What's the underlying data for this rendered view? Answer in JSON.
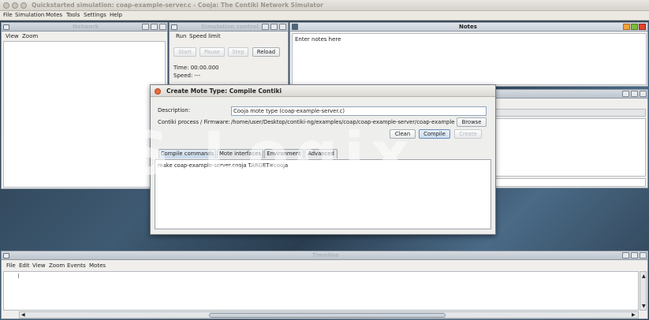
{
  "window": {
    "title": "Quickstarted simulation: coap-example-server.c - Cooja: The Contiki Network Simulator"
  },
  "menubar": [
    "File",
    "Simulation",
    "Motes",
    "Tools",
    "Settings",
    "Help"
  ],
  "network": {
    "title": "Network",
    "menu": [
      "View",
      "Zoom"
    ]
  },
  "simcontrol": {
    "title": "Simulation control",
    "menu": [
      "Run",
      "Speed limit"
    ],
    "buttons": [
      "Start",
      "Pause",
      "Step",
      "Reload"
    ],
    "time": "Time: 00:00.000",
    "speed": "Speed: ---"
  },
  "notes": {
    "title": "Notes",
    "text": "Enter notes here"
  },
  "timeline": {
    "title": "Timeline",
    "menu": [
      "File",
      "Edit",
      "View",
      "Zoom",
      "Events",
      "Motes"
    ]
  },
  "dialog": {
    "title": "Create Mote Type: Compile Contiki",
    "description_label": "Description:",
    "description_value": "Cooja mote type (coap-example-server.c)",
    "firmware_label": "Contiki process / Firmware:",
    "firmware_value": "/home/user/Desktop/contiki-ng/examples/coap/coap-example-server/coap-example-",
    "browse": "Browse",
    "clean": "Clean",
    "compile": "Compile",
    "create": "Create",
    "tabs": [
      "Compile commands",
      "Mote interfaces",
      "Environment",
      "Advanced"
    ],
    "commands": "make coap-example-server.cooja TARGET=cooja"
  },
  "watermark": "S Logix",
  "colors": {
    "desktop": "#3a4b5a",
    "frame_title": "#bcc4cd",
    "close_red": "#e66b3c",
    "tab_active": "#c7d8ea"
  }
}
